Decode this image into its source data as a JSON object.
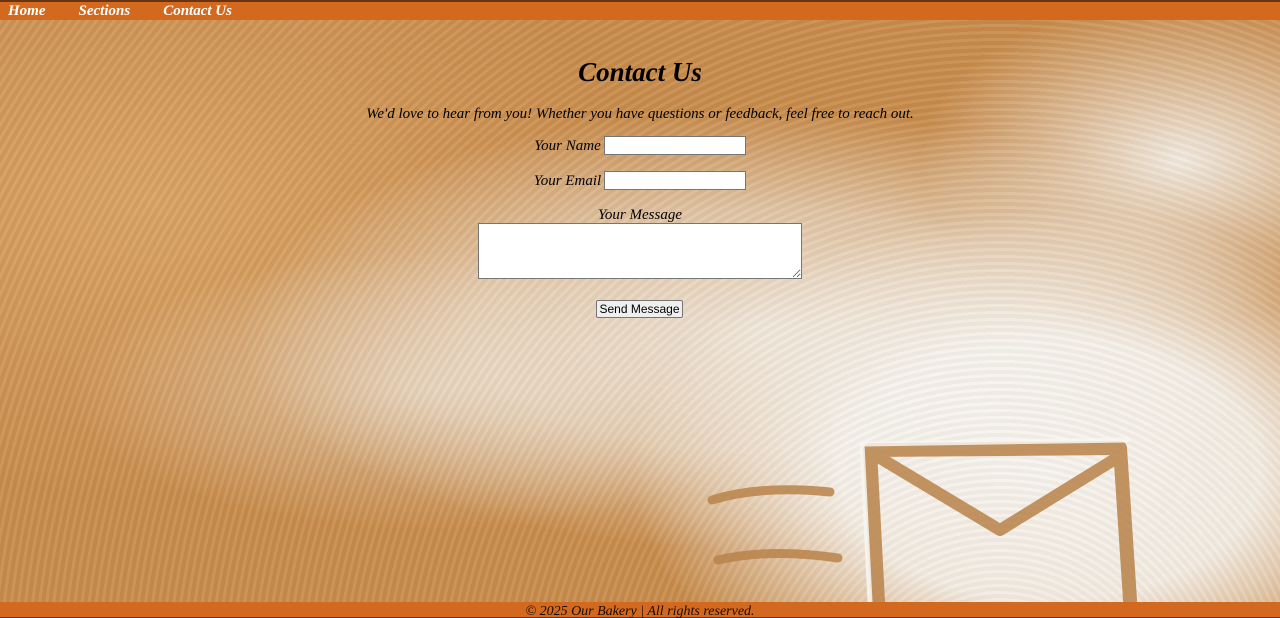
{
  "nav": {
    "items": [
      {
        "label": "Home"
      },
      {
        "label": "Sections"
      },
      {
        "label": "Contact Us"
      }
    ]
  },
  "main": {
    "title": "Contact Us",
    "intro": "We'd love to hear from you! Whether you have questions or feedback, feel free to reach out.",
    "form": {
      "name_label": "Your Name",
      "name_value": "",
      "email_label": "Your Email",
      "email_value": "",
      "message_label": "Your Message",
      "message_value": "",
      "submit_label": "Send Message"
    }
  },
  "footer": {
    "text": "© 2025 Our Bakery | All rights reserved."
  },
  "colors": {
    "nav_background": "#d2691e",
    "background_flour": "#cf9656"
  },
  "icons": {
    "background_drawing": "envelope-icon"
  }
}
